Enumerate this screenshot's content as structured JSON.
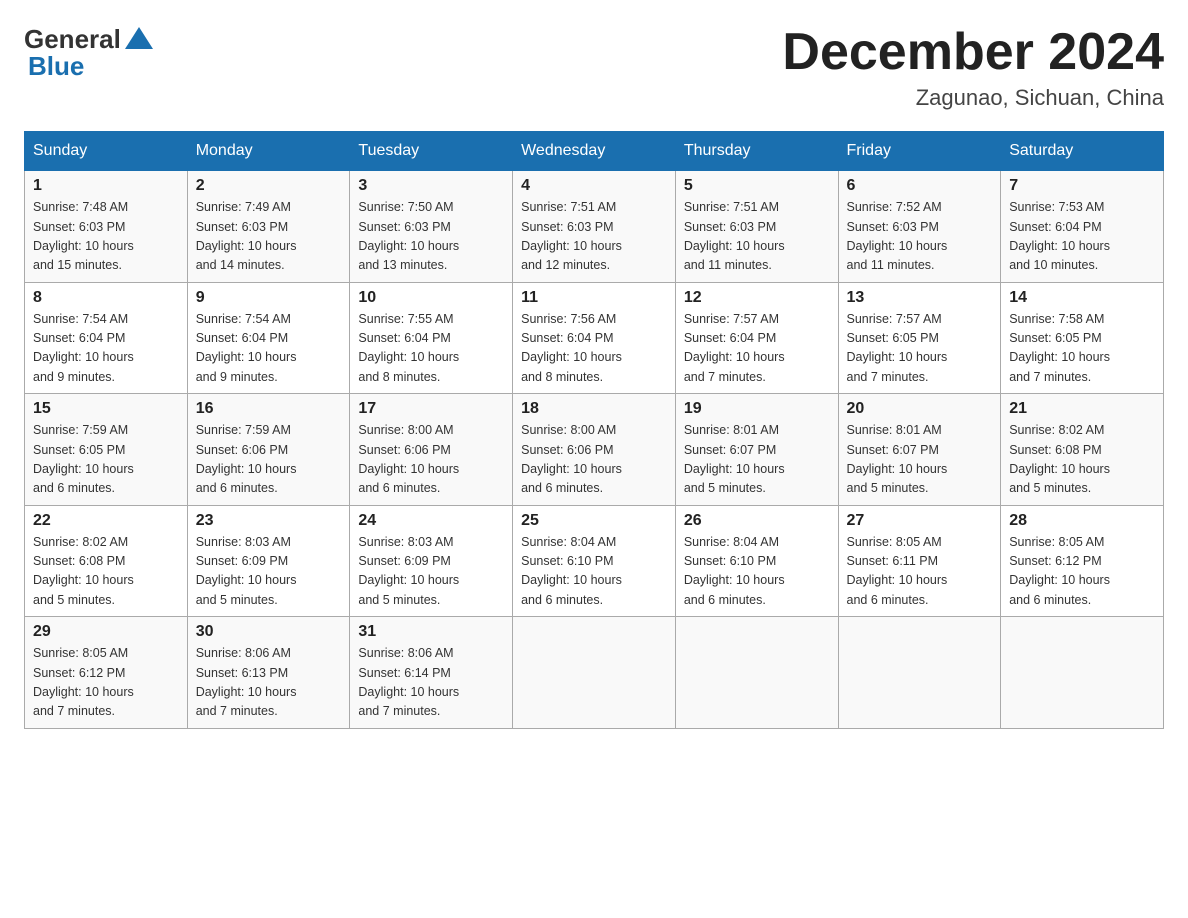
{
  "header": {
    "logo_general": "General",
    "logo_blue": "Blue",
    "title": "December 2024",
    "subtitle": "Zagunao, Sichuan, China"
  },
  "columns": [
    "Sunday",
    "Monday",
    "Tuesday",
    "Wednesday",
    "Thursday",
    "Friday",
    "Saturday"
  ],
  "weeks": [
    [
      {
        "day": "1",
        "sunrise": "7:48 AM",
        "sunset": "6:03 PM",
        "daylight": "10 hours and 15 minutes."
      },
      {
        "day": "2",
        "sunrise": "7:49 AM",
        "sunset": "6:03 PM",
        "daylight": "10 hours and 14 minutes."
      },
      {
        "day": "3",
        "sunrise": "7:50 AM",
        "sunset": "6:03 PM",
        "daylight": "10 hours and 13 minutes."
      },
      {
        "day": "4",
        "sunrise": "7:51 AM",
        "sunset": "6:03 PM",
        "daylight": "10 hours and 12 minutes."
      },
      {
        "day": "5",
        "sunrise": "7:51 AM",
        "sunset": "6:03 PM",
        "daylight": "10 hours and 11 minutes."
      },
      {
        "day": "6",
        "sunrise": "7:52 AM",
        "sunset": "6:03 PM",
        "daylight": "10 hours and 11 minutes."
      },
      {
        "day": "7",
        "sunrise": "7:53 AM",
        "sunset": "6:04 PM",
        "daylight": "10 hours and 10 minutes."
      }
    ],
    [
      {
        "day": "8",
        "sunrise": "7:54 AM",
        "sunset": "6:04 PM",
        "daylight": "10 hours and 9 minutes."
      },
      {
        "day": "9",
        "sunrise": "7:54 AM",
        "sunset": "6:04 PM",
        "daylight": "10 hours and 9 minutes."
      },
      {
        "day": "10",
        "sunrise": "7:55 AM",
        "sunset": "6:04 PM",
        "daylight": "10 hours and 8 minutes."
      },
      {
        "day": "11",
        "sunrise": "7:56 AM",
        "sunset": "6:04 PM",
        "daylight": "10 hours and 8 minutes."
      },
      {
        "day": "12",
        "sunrise": "7:57 AM",
        "sunset": "6:04 PM",
        "daylight": "10 hours and 7 minutes."
      },
      {
        "day": "13",
        "sunrise": "7:57 AM",
        "sunset": "6:05 PM",
        "daylight": "10 hours and 7 minutes."
      },
      {
        "day": "14",
        "sunrise": "7:58 AM",
        "sunset": "6:05 PM",
        "daylight": "10 hours and 7 minutes."
      }
    ],
    [
      {
        "day": "15",
        "sunrise": "7:59 AM",
        "sunset": "6:05 PM",
        "daylight": "10 hours and 6 minutes."
      },
      {
        "day": "16",
        "sunrise": "7:59 AM",
        "sunset": "6:06 PM",
        "daylight": "10 hours and 6 minutes."
      },
      {
        "day": "17",
        "sunrise": "8:00 AM",
        "sunset": "6:06 PM",
        "daylight": "10 hours and 6 minutes."
      },
      {
        "day": "18",
        "sunrise": "8:00 AM",
        "sunset": "6:06 PM",
        "daylight": "10 hours and 6 minutes."
      },
      {
        "day": "19",
        "sunrise": "8:01 AM",
        "sunset": "6:07 PM",
        "daylight": "10 hours and 5 minutes."
      },
      {
        "day": "20",
        "sunrise": "8:01 AM",
        "sunset": "6:07 PM",
        "daylight": "10 hours and 5 minutes."
      },
      {
        "day": "21",
        "sunrise": "8:02 AM",
        "sunset": "6:08 PM",
        "daylight": "10 hours and 5 minutes."
      }
    ],
    [
      {
        "day": "22",
        "sunrise": "8:02 AM",
        "sunset": "6:08 PM",
        "daylight": "10 hours and 5 minutes."
      },
      {
        "day": "23",
        "sunrise": "8:03 AM",
        "sunset": "6:09 PM",
        "daylight": "10 hours and 5 minutes."
      },
      {
        "day": "24",
        "sunrise": "8:03 AM",
        "sunset": "6:09 PM",
        "daylight": "10 hours and 5 minutes."
      },
      {
        "day": "25",
        "sunrise": "8:04 AM",
        "sunset": "6:10 PM",
        "daylight": "10 hours and 6 minutes."
      },
      {
        "day": "26",
        "sunrise": "8:04 AM",
        "sunset": "6:10 PM",
        "daylight": "10 hours and 6 minutes."
      },
      {
        "day": "27",
        "sunrise": "8:05 AM",
        "sunset": "6:11 PM",
        "daylight": "10 hours and 6 minutes."
      },
      {
        "day": "28",
        "sunrise": "8:05 AM",
        "sunset": "6:12 PM",
        "daylight": "10 hours and 6 minutes."
      }
    ],
    [
      {
        "day": "29",
        "sunrise": "8:05 AM",
        "sunset": "6:12 PM",
        "daylight": "10 hours and 7 minutes."
      },
      {
        "day": "30",
        "sunrise": "8:06 AM",
        "sunset": "6:13 PM",
        "daylight": "10 hours and 7 minutes."
      },
      {
        "day": "31",
        "sunrise": "8:06 AM",
        "sunset": "6:14 PM",
        "daylight": "10 hours and 7 minutes."
      },
      null,
      null,
      null,
      null
    ]
  ],
  "labels": {
    "sunrise": "Sunrise:",
    "sunset": "Sunset:",
    "daylight": "Daylight:"
  }
}
